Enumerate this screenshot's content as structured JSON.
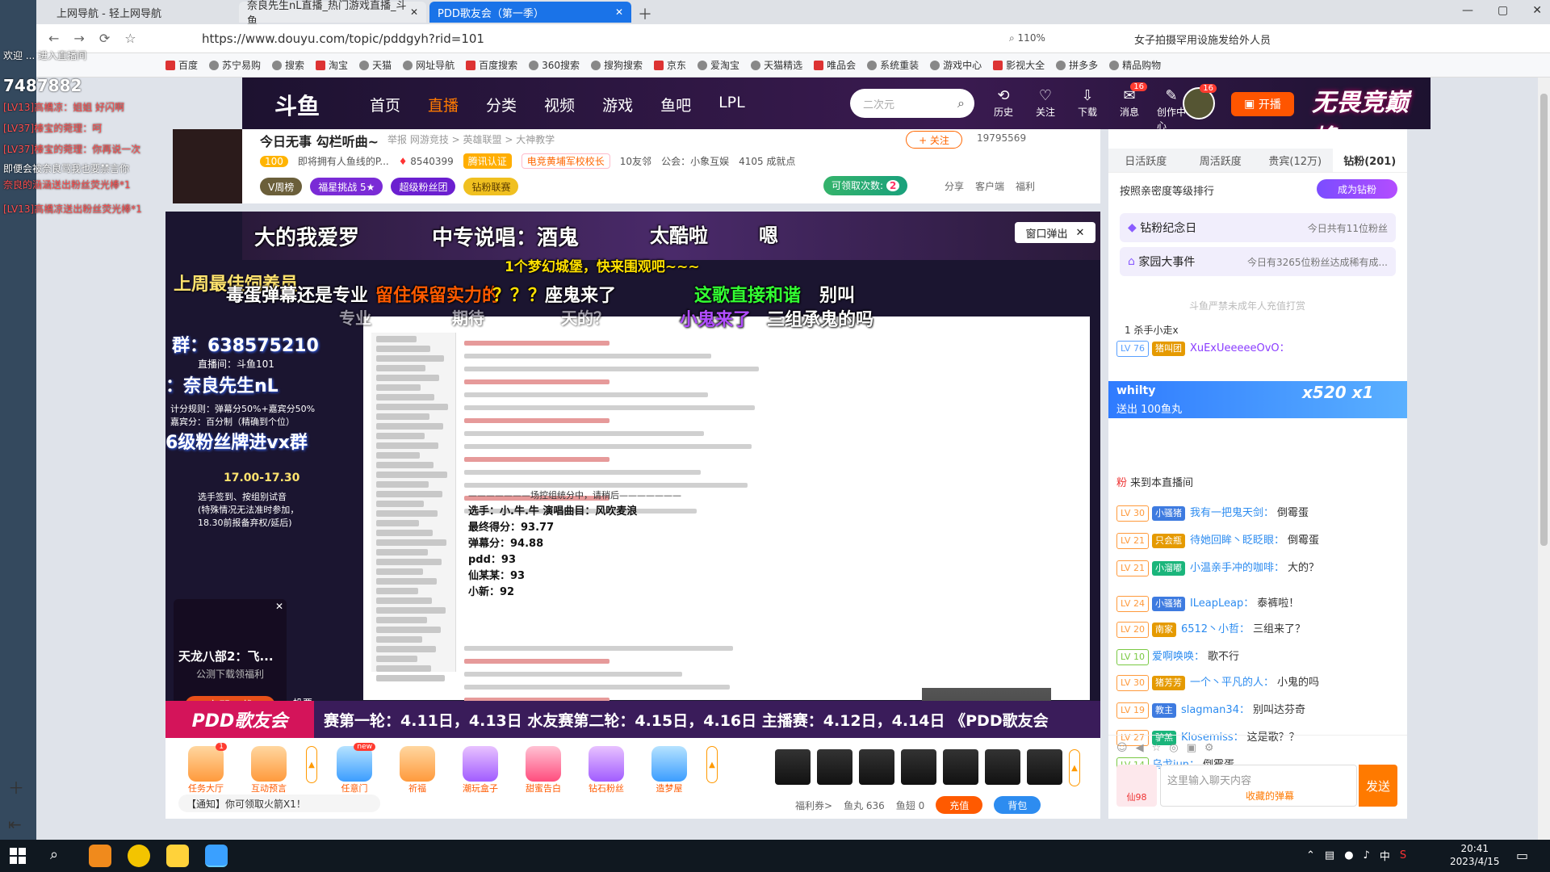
{
  "browser": {
    "tabs": [
      {
        "label": "上网导航 - 轻上网导航"
      },
      {
        "label": "奈良先生nL直播_热门游戏直播_斗鱼"
      },
      {
        "label": "PDD歌友会（第一季）"
      }
    ],
    "url": "https://www.douyu.com/topic/pddgyh?rid=101",
    "zoom": "110%",
    "search_suggest": "女子拍摄罕用设施发给外人员",
    "bookmarks": [
      "百度",
      "苏宁易购",
      "搜索",
      "淘宝",
      "天猫",
      "网址导航",
      "百度搜索",
      "360搜索",
      "搜狗搜索",
      "京东",
      "爱淘宝",
      "天猫精选",
      "唯品会",
      "系统重装",
      "游戏中心",
      "影视大全",
      "拼多多",
      "精品购物"
    ]
  },
  "left_overlay": {
    "lines": [
      {
        "text": "欢迎 ... 进入直播间",
        "red": false
      },
      {
        "text": "7487882",
        "red": false
      },
      {
        "text": "[LV13]高橋凉：姐姐 好闪啊",
        "red": true
      },
      {
        "text": "[LV37]榛宝的菀理：呵",
        "red": true
      },
      {
        "text": "[LV37]榛宝的菀理：你再说一次",
        "red": true
      },
      {
        "text": "即便会被奈良骂我也要禁言你",
        "red": false
      },
      {
        "text": "奈良的涵涵送出粉丝荧光棒*1",
        "red": true
      },
      {
        "text": "[LV13]高橋凉送出粉丝荧光棒*1",
        "red": true
      }
    ]
  },
  "header": {
    "logo": "斗鱼",
    "nav": [
      "首页",
      "直播",
      "分类",
      "视频",
      "游戏",
      "鱼吧",
      "LPL"
    ],
    "active_nav": "直播",
    "search_placeholder": "二次元",
    "icons": [
      {
        "label": "历史",
        "glyph": "⟲",
        "badge": ""
      },
      {
        "label": "关注",
        "glyph": "♡",
        "badge": ""
      },
      {
        "label": "下载",
        "glyph": "⇩",
        "badge": ""
      },
      {
        "label": "消息",
        "glyph": "✉",
        "badge": "16"
      },
      {
        "label": "创作中心",
        "glyph": "✎",
        "badge": ""
      }
    ],
    "avatar_badge": "16",
    "open_live": "开播",
    "banner": "无畏竞巅峰"
  },
  "room": {
    "title": "今日无事 勾栏听曲~",
    "category": "举报  网游竞技 > 英雄联盟 > 大神教学",
    "follow": "+ 关注",
    "follow_count": "19795569",
    "level": "100",
    "desc": "即将拥有人鱼线的P...",
    "hot": "8540399",
    "verified": "腾讯认证",
    "tag": "电竞黄埔军校校长",
    "friends": "10友邻",
    "guild": "公会：小象互娱",
    "achievements": "4105 成就点",
    "badges": [
      "V周榜",
      "福星挑战 5★",
      "超级粉丝团",
      "钻粉联赛"
    ],
    "claim": "可领取次数:",
    "claim_count": "2",
    "actions": [
      "分享",
      "客户端",
      "福利"
    ]
  },
  "video": {
    "popout": "窗口弹出",
    "danmaku": [
      {
        "text": "大的我爱罗",
        "color": "#ffffff"
      },
      {
        "text": "中专说唱：酒鬼",
        "color": "#ffffff"
      },
      {
        "text": "太酷啦",
        "color": "#ffffff"
      },
      {
        "text": "嗯",
        "color": "#ffffff"
      },
      {
        "text": "1个梦幻城堡，快来围观吧~~~",
        "color": "#ffe000"
      },
      {
        "text": "上周最佳饲养员",
        "color": "#ffe36e"
      },
      {
        "text": "毒蛋弹幕还是专业",
        "color": "#ffffff"
      },
      {
        "text": "留住保留实力的",
        "color": "#ff5a00"
      },
      {
        "text": "？？？",
        "color": "#ffe000"
      },
      {
        "text": "座鬼来了",
        "color": "#ffffff"
      },
      {
        "text": "这歌直接和谐",
        "color": "#33ff33"
      },
      {
        "text": "别叫",
        "color": "#ffffff"
      },
      {
        "text": "小鬼来了",
        "color": "#b14dff"
      },
      {
        "text": "三组承鬼的吗",
        "color": "#ffffff"
      },
      {
        "text": "专业",
        "color": "#ffffff"
      },
      {
        "text": "期待",
        "color": "#ffffff"
      },
      {
        "text": "天的？",
        "color": "#ffffff"
      }
    ],
    "overlay": {
      "qq_group": "群：638575210",
      "douyin": "：奈良先生nL",
      "fan_group": "6级粉丝牌进vx群",
      "room_no": "直播间：斗鱼101",
      "scoring": "计分规则：弹幕分50%+嘉宾分50%",
      "guest_score": "嘉宾分：百分制（精确到个位）",
      "time": "17.00-17.30",
      "rules": "选手签到、按组别试音\n(特殊情况无法准时参加，\n18.30前报备弃权/延后)"
    },
    "scoreboard": {
      "divider": "———————场控组统分中，请稍后———————",
      "player": "选手：小.牛.牛  演唱曲目：风吹麦浪",
      "final": "最终得分：93.77",
      "danmu": "弹幕分：94.88",
      "pdd": "pdd：93",
      "xian": "仙某某：93",
      "xiaoxin": "小新：92"
    },
    "game_ad": {
      "title": "天龙八部2：飞...",
      "sub": "公测下载领福利",
      "button": "立即下载",
      "vote": "投票"
    },
    "pdd_logo": "PDD歌友会",
    "scroll_text": "赛第一轮：4.11日，4.13日  水友赛第二轮：4.15日，4.16日  主播赛：4.12日，4.14日  《PDD歌友会"
  },
  "gift_bar": {
    "gifts": [
      {
        "label": "任务大厅",
        "badge": "1"
      },
      {
        "label": "互动预言",
        "badge": ""
      },
      {
        "label": "任意门",
        "badge": "new"
      },
      {
        "label": "祈福",
        "badge": ""
      },
      {
        "label": "潮玩盒子",
        "badge": ""
      },
      {
        "label": "甜蜜告白",
        "badge": ""
      },
      {
        "label": "钻石粉丝",
        "badge": ""
      },
      {
        "label": "造梦屋",
        "badge": ""
      }
    ],
    "notice": "【通知】你可领取火箭X1！",
    "coupon": "福利券>",
    "fish_ball": "鱼丸 636",
    "fish_fin": "鱼翅 0",
    "recharge": "充值",
    "backpack": "背包"
  },
  "right_panel": {
    "tabs": [
      "日活跃度",
      "周活跃度",
      "贵宾(12万)",
      "钻粉(201)"
    ],
    "active_tab": "钻粉(201)",
    "rank_hint": "按照亲密度等级排行",
    "become_fan": "成为钻粉",
    "card1_title": "钻粉纪念日",
    "card1_sub": "今日共有11位粉丝",
    "card2_title": "家园大事件",
    "card2_sub": "今日有3265位粉丝达成稀有成...",
    "no_fan": "斗鱼严禁未成年人充值打赏",
    "killer": "1  杀手小走x",
    "gift_popup": {
      "user": "whilty",
      "send": "送出  100鱼丸",
      "count": "x520 x1"
    },
    "chat": [
      {
        "lvl": "LV 76",
        "badge": "猪叫团",
        "user": "XuExUeeeeeOvO：",
        "msg": ""
      },
      {
        "lvl": "",
        "badge": "",
        "user": "粉",
        "msg": "来到本直播间"
      },
      {
        "lvl": "LV 30",
        "badge": "小骚猪",
        "user": "我有一把鬼天剑：",
        "msg": "倒霉蛋"
      },
      {
        "lvl": "LV 21",
        "badge": "只会瓶",
        "user": "待她回眸丶眨眨眼：",
        "msg": "倒霉蛋"
      },
      {
        "lvl": "LV 21",
        "badge": "小溜嘟",
        "user": "小温亲手冲的咖啡：",
        "msg": "大的？"
      },
      {
        "lvl": "LV 24",
        "badge": "小骚猪",
        "user": "ILeapLeap：",
        "msg": "泰裤啦！"
      },
      {
        "lvl": "LV 20",
        "badge": "南家",
        "user": "6512丶小哲：",
        "msg": "三组来了？"
      },
      {
        "lvl": "LV 10",
        "badge": "",
        "user": "爱啊唤唤：",
        "msg": "歌不行"
      },
      {
        "lvl": "LV 30",
        "badge": "猪芳芳",
        "user": "一个丶平凡的人：",
        "msg": "小鬼的吗"
      },
      {
        "lvl": "LV 19",
        "badge": "教主",
        "user": "slagman34：",
        "msg": "别叫达芬奇"
      },
      {
        "lvl": "LV 27",
        "badge": "驴羔",
        "user": "Klosemiss：",
        "msg": "这是歌？？"
      },
      {
        "lvl": "LV 14",
        "badge": "",
        "user": "乌戈jun：",
        "msg": "倒霉蛋"
      }
    ],
    "fan_chip": "仙98",
    "input_placeholder": "这里输入聊天内容",
    "collect": "收藏的弹幕",
    "send": "发送"
  },
  "taskbar": {
    "time": "20:41",
    "date": "2023/4/15",
    "ime": "中"
  }
}
